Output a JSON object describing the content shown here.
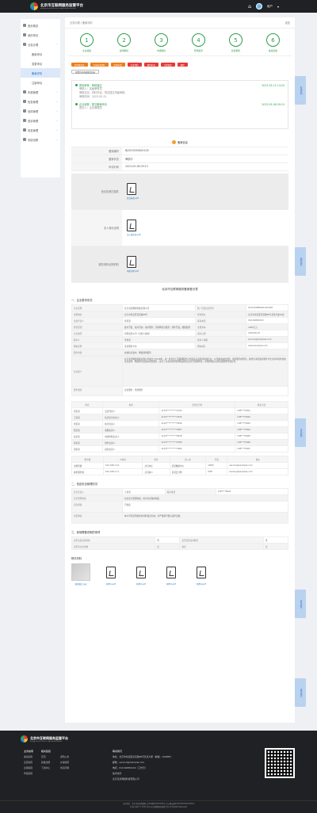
{
  "header": {
    "brand_zh": "北京市互联网服务监管平台",
    "brand_en": "Beijing Internet Service Supervision Platform",
    "user_name": "用户"
  },
  "sidebar": {
    "items": [
      {
        "label": "首页概览",
        "arrow": ""
      },
      {
        "label": "我的申请",
        "arrow": ""
      },
      {
        "label": "业务办理",
        "arrow": "⌃"
      },
      {
        "label": "备案申请",
        "arrow": "",
        "sub": true
      },
      {
        "label": "变更申请",
        "arrow": "",
        "sub": true
      },
      {
        "label": "备案详情",
        "arrow": "",
        "sub": true,
        "active": true
      },
      {
        "label": "注销申请",
        "arrow": "",
        "sub": true
      },
      {
        "label": "年报管理",
        "arrow": "⌄"
      },
      {
        "label": "检查管理",
        "arrow": "⌄"
      },
      {
        "label": "信用管理",
        "arrow": "⌄"
      },
      {
        "label": "投诉管理",
        "arrow": "⌄"
      },
      {
        "label": "信息管理",
        "arrow": "⌄"
      },
      {
        "label": "系统设置",
        "arrow": "⌄"
      }
    ]
  },
  "breadcrumb": "业务办理 / 备案详情",
  "back_label": "返回",
  "steps": [
    {
      "num": "1",
      "label": "企业填报"
    },
    {
      "num": "2",
      "label": "属地审核"
    },
    {
      "num": "3",
      "label": "市级审核"
    },
    {
      "num": "4",
      "label": "现场核查"
    },
    {
      "num": "5",
      "label": "复核审批"
    },
    {
      "num": "6",
      "label": "备案完成"
    }
  ],
  "actions": [
    {
      "label": "打印备案表",
      "style": "orange"
    },
    {
      "label": "导出申请材料",
      "style": "orange"
    },
    {
      "label": "变更申请",
      "style": "orange"
    },
    {
      "label": "补正材料",
      "style": "red"
    },
    {
      "label": "撤回申请",
      "style": "red"
    },
    {
      "label": "注销备案",
      "style": "red"
    },
    {
      "label": "删除",
      "style": "red"
    }
  ],
  "outline_button": "查看历史审核意见记录",
  "log": [
    {
      "title": "属地审核 · 审核通过",
      "time": "2023-05-12 14:20",
      "lines": [
        "审核人：区级审核员",
        "审核意见：材料齐全，同意提交市级审核。",
        "审核时间：2023-05-12"
      ]
    },
    {
      "title": "企业填报 · 提交备案申请",
      "time": "2023-05-08 09:15",
      "lines": [
        "提交人：企业管理员"
      ]
    }
  ],
  "section_title": "备案信息",
  "summary": [
    {
      "k": "备案编号",
      "v": "BJ2023050800128"
    },
    {
      "k": "备案状态",
      "v": "审核中"
    },
    {
      "k": "申请时间",
      "v": "2023-05-08 09:15"
    }
  ],
  "files": [
    {
      "k": "营业执照扫描件",
      "link": "营业执照.pdf"
    },
    {
      "k": "法人身份证明",
      "link": "法人身份证.pdf"
    },
    {
      "k": "服务场所证明材料",
      "link": "场所证明.pdf"
    }
  ],
  "doc_title": "北京市互联网服务备案登记表",
  "basic_title": "一、企业基本情况",
  "basic_rows": [
    [
      "企业名称",
      "北京某某网络科技有限公司",
      "统一社会信用代码",
      "91110108MA01XXXX0X"
    ],
    [
      "注册地址",
      "北京市海淀区某某路88号",
      "经营地址",
      "北京市海淀区某某路88号某某大厦10层"
    ],
    [
      "法定代表人",
      "张某某",
      "联系电话",
      "010-6288XXXX"
    ],
    [
      "经营范围",
      "技术开发、技术咨询、技术服务；互联网信息服务；软件开发；数据处理",
      "注册资本",
      "1000万元"
    ],
    [
      "企业类型",
      "有限责任公司（自然人投资）",
      "成立日期",
      "2018-06-15"
    ],
    [
      "联系人",
      "李某某",
      "联系人邮箱",
      "service@example.com"
    ],
    [
      "网站名称",
      "某某服务平台",
      "网站域名",
      "www.example.com"
    ],
    [
      "服务内容",
      "在线信息发布、网络预约服务"
    ]
  ],
  "intro_label": "企业简介",
  "intro_text": "北京某某网络科技有限公司成立于2018年，是一家专注于互联网服务平台建设与运营的科技企业。公司秉承诚信经营、规范服务的理念，依托自主研发的服务平台为用户提供在线信息发布、网络预约及相关配套服务，建立了完善的内部管理制度和信息安全保障体系，并按照相关法律法规要求开展业务。",
  "scope_label": "服务类别",
  "scope_text": "信息服务、预约服务",
  "staff_head": [
    "姓名",
    "职务",
    "身份证号码",
    "联系方式"
  ],
  "staff_rows": [
    [
      "张某某",
      "法定代表人",
      "1101**********1234",
      "138****0001"
    ],
    [
      "王某某",
      "信息安全负责人",
      "1101**********2345",
      "138****0002"
    ],
    [
      "刘某某",
      "技术负责人",
      "1101**********3456",
      "138****0003"
    ],
    [
      "陈某某",
      "客服负责人",
      "1101**********4567",
      "138****0004"
    ],
    [
      "赵某某",
      "内容审核负责人",
      "1101**********5678",
      "138****0005"
    ],
    [
      "孙某某",
      "财务负责人",
      "1101**********6789",
      "138****0006"
    ],
    [
      "周某某",
      "运营负责人",
      "1101**********7890",
      "138****0007"
    ]
  ],
  "server_head": [
    "服务器",
    "IP地址",
    "机房",
    "接入商",
    "带宽",
    "备注"
  ],
  "server_rows": [
    [
      "主服务器",
      "192.168.1.10",
      "北京亦庄",
      "某某数据中心",
      "100M",
      "service@example.com"
    ],
    [
      "备份服务器",
      "192.168.1.11",
      "北京顺义",
      "某某云计算",
      "50M",
      "backup@example.com"
    ]
  ],
  "security_title": "二、信息安全管理情况",
  "security_rows": [
    [
      "安全负责人",
      "王某某",
      "联系电话",
      "138****0002"
    ],
    [
      "安全管理制度",
      "信息安全管理制度、用户信息保护制度"
    ]
  ],
  "security_extra": [
    {
      "k": "应急预案",
      "v": "已制定"
    },
    {
      "k": "承诺事项",
      "v": "本公司承诺所提交的材料真实有效，并严格遵守相关法律法规。"
    }
  ],
  "other_title": "三、其他需要说明的事项",
  "other_rows": [
    [
      "是否涉及前置审批",
      "否",
      "是否涉及境外服务",
      "否"
    ],
    [
      "是否有分支机构",
      "无",
      "备注",
      "无"
    ]
  ],
  "attach_title": "附件材料",
  "attachments": [
    {
      "name": "现场照片.jpg",
      "type": "image"
    },
    {
      "name": "附件1.pdf",
      "type": "pdf"
    },
    {
      "name": "附件2.pdf",
      "type": "pdf"
    },
    {
      "name": "附件3.pdf",
      "type": "pdf"
    },
    {
      "name": "附件4.pdf",
      "type": "pdf"
    }
  ],
  "float_tabs": [
    "在线咨询",
    "操作指南",
    "常见问题",
    "意见反馈",
    "返回顶部"
  ],
  "footer": {
    "brand_zh": "北京市互联网服务监管平台",
    "brand_en": "Beijing Internet Service Supervision Platform",
    "col1_title": "业务指南",
    "col1": [
      "备案指南",
      "变更指南",
      "注销指南",
      "年报指南"
    ],
    "col2_title": "相关链接",
    "col2": [
      "首页",
      "通知公告",
      "政策法规",
      "办事指南",
      "下载中心",
      "常见问题"
    ],
    "contact_title": "联系我们",
    "contact": [
      "地址：北京市海淀区某某路88号某某大厦（邮编：100080）",
      "邮箱：service@example.com",
      "电话：010-6288XXXX（工作日）",
      "技术支持",
      "北京某某网络科技有限公司"
    ],
    "bottom1": "主办单位：北京市某某管理局  京ICP备XXXXXXXX号  京公网安备XXXXXXXXXXXXXX号",
    "bottom2": "Copyright © 2023 北京市互联网服务监管平台 All Rights Reserved"
  }
}
